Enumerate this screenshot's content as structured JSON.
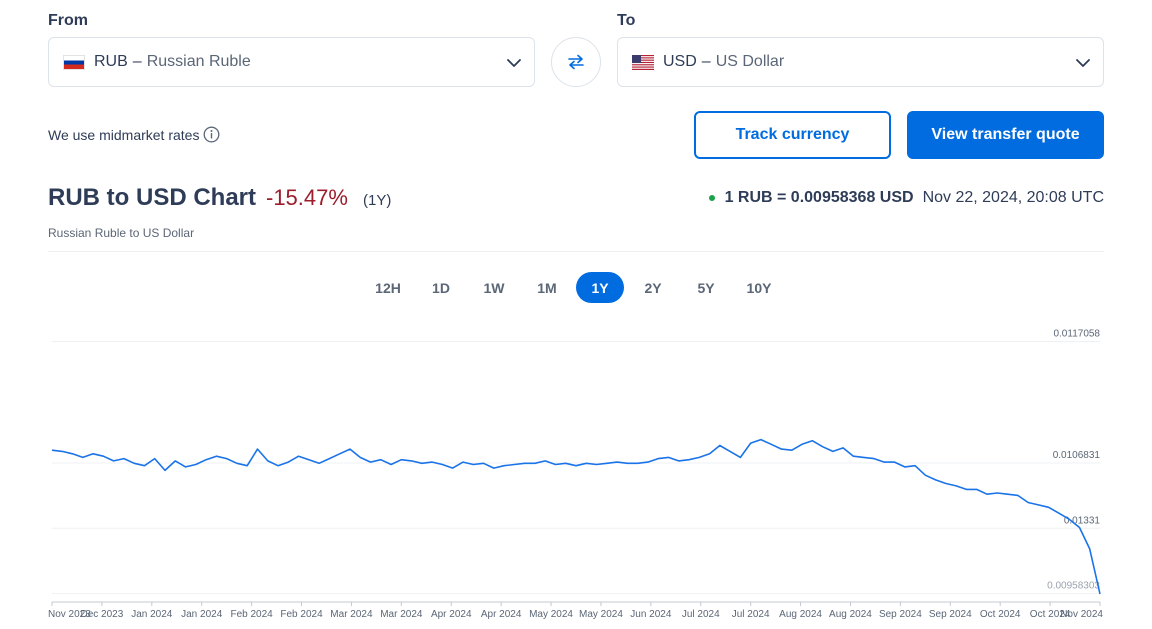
{
  "from": {
    "label": "From",
    "code": "RUB",
    "dash": "–",
    "name": "Russian Ruble",
    "flag": "russia-flag-icon"
  },
  "to": {
    "label": "To",
    "code": "USD",
    "dash": "–",
    "name": "US Dollar",
    "flag": "us-flag-icon"
  },
  "midmarket_text": "We use midmarket rates",
  "buttons": {
    "track": "Track currency",
    "quote": "View transfer quote"
  },
  "header": {
    "title": "RUB to USD Chart",
    "change": "-15.47%",
    "period": "(1Y)",
    "subtitle": "Russian Ruble to US Dollar",
    "rate": "1 RUB = 0.00958368 USD",
    "timestamp": "Nov 22, 2024, 20:08 UTC"
  },
  "periods": [
    "12H",
    "1D",
    "1W",
    "1M",
    "1Y",
    "2Y",
    "5Y",
    "10Y"
  ],
  "active_period": "1Y",
  "colors": {
    "accent": "#006ce0",
    "negative": "#9c1d2c",
    "live": "#1aa34a",
    "line": "#1a73e8"
  },
  "chart_data": {
    "type": "line",
    "series": [
      {
        "values": [
          0.01079,
          0.01078,
          0.01076,
          0.01073,
          0.01076,
          0.01074,
          0.0107,
          0.01072,
          0.01068,
          0.01066,
          0.01072,
          0.01062,
          0.0107,
          0.01065,
          0.01067,
          0.01071,
          0.01074,
          0.01072,
          0.01068,
          0.01066,
          0.0108,
          0.0107,
          0.01066,
          0.01069,
          0.01074,
          0.01071,
          0.01068,
          0.01072,
          0.01076,
          0.0108,
          0.01073,
          0.01069,
          0.01071,
          0.01067,
          0.01071,
          0.0107,
          0.01068,
          0.01069,
          0.01067,
          0.01064,
          0.01069,
          0.01067,
          0.01068,
          0.01064,
          0.01066,
          0.01067,
          0.01068,
          0.01068,
          0.0107,
          0.01067,
          0.01068,
          0.01066,
          0.01068,
          0.01067,
          0.01068,
          0.01069,
          0.01068,
          0.01068,
          0.01069,
          0.01072,
          0.01073,
          0.0107,
          0.01071,
          0.01073,
          0.01076,
          0.01083,
          0.01078,
          0.01073,
          0.01085,
          0.01088,
          0.01084,
          0.0108,
          0.01079,
          0.01084,
          0.01087,
          0.01082,
          0.01078,
          0.01081,
          0.01074,
          0.01073,
          0.01072,
          0.01069,
          0.01069,
          0.01065,
          0.01066,
          0.01058,
          0.01054,
          0.01051,
          0.01049,
          0.01046,
          0.01046,
          0.01042,
          0.01043,
          0.01042,
          0.01041,
          0.01035,
          0.01033,
          0.01031,
          0.01026,
          0.01021,
          0.01014,
          0.00996,
          0.00958
        ],
        "color": "#1a73e8"
      }
    ],
    "x_ticks": [
      "Nov 2023",
      "Dec 2023",
      "Jan 2024",
      "Jan 2024",
      "Feb 2024",
      "Feb 2024",
      "Mar 2024",
      "Mar 2024",
      "Apr 2024",
      "Apr 2024",
      "May 2024",
      "May 2024",
      "Jun 2024",
      "Jul 2024",
      "Jul 2024",
      "Aug 2024",
      "Aug 2024",
      "Sep 2024",
      "Sep 2024",
      "Oct 2024",
      "Oct 2024",
      "Nov 2024"
    ],
    "y_ticks": [
      {
        "value": 0.0117058,
        "label": "0.0117058"
      },
      {
        "value": 0.0106831,
        "label": "0.0106831"
      },
      {
        "value": 0.0101331,
        "label": "0.01331"
      },
      {
        "value": 0.00958303,
        "label": "0.00958303"
      }
    ],
    "ylim": [
      0.00958,
      0.01176
    ],
    "grid": true
  }
}
